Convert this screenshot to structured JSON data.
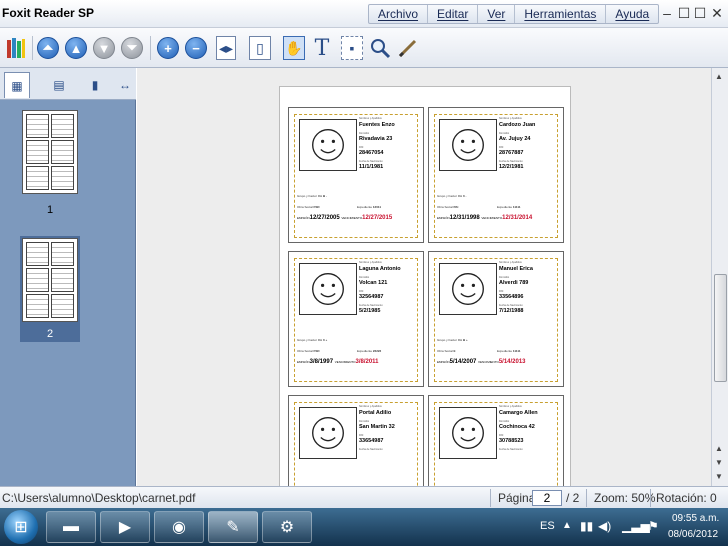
{
  "app": {
    "title": "Foxit Reader SP"
  },
  "menu": [
    {
      "label": "Archivo"
    },
    {
      "label": "Editar"
    },
    {
      "label": "Ver"
    },
    {
      "label": "Herramientas"
    },
    {
      "label": "Ayuda"
    }
  ],
  "window_controls": {
    "minimize": "–",
    "restore": "☐",
    "maximize": "☐",
    "close": "✕"
  },
  "toolbar_icons": [
    "library-icon",
    "first-page-icon",
    "previous-page-icon",
    "next-page-icon",
    "last-page-icon",
    "zoom-in-icon",
    "zoom-out-icon",
    "page-layout-icon",
    "single-page-icon",
    "hand-icon",
    "text-select-icon",
    "snapshot-icon",
    "zoom-tool-icon",
    "annotation-icon"
  ],
  "left_panel": {
    "tabs": [
      "thumbnails-tab-icon",
      "pages-tab-icon",
      "bookmarks-tab-icon",
      "expand-icon"
    ],
    "thumbnails": [
      {
        "page": "1"
      },
      {
        "page": "2"
      }
    ],
    "selected_page": "2"
  },
  "cards": [
    {
      "field1_label": "Nombres y Apellidos",
      "name": "Fuentes Enzo",
      "field2_label": "Domicilio",
      "address": "Rivadavia 23",
      "field3_label": "DNI",
      "dni": "28467054",
      "field4_label": "Fecha de Nacimiento",
      "birth": "11/1/1981",
      "blood_label": "Grupo y Factor RH",
      "blood": "B -",
      "insurance_label": "Obra Social",
      "insurance": "FSD",
      "file_label": "Expediente",
      "file": "12011",
      "issue_label": "EMISIÓN",
      "issue": "12/27/2005",
      "expiry_label": "VENCIMIENTO",
      "expiry": "12/27/2015"
    },
    {
      "field1_label": "Nombres y Apellidos",
      "name": "Cardozo Juan",
      "field2_label": "Domicilio",
      "address": "Av. Jujuy 24",
      "field3_label": "DNI",
      "dni": "28767887",
      "field4_label": "Fecha de Nacimiento",
      "birth": "12/2/1981",
      "blood_label": "Grupo y Factor RH",
      "blood": "0 -",
      "insurance_label": "Obra Social",
      "insurance": "PAI",
      "file_label": "Expediente",
      "file": "11111",
      "issue_label": "EMISIÓN",
      "issue": "12/31/1998",
      "expiry_label": "VENCIMIENTO",
      "expiry": "12/31/2014"
    },
    {
      "field1_label": "Nombres y Apellidos",
      "name": "Laguna Antonio",
      "field2_label": "Domicilio",
      "address": "Volcan 121",
      "field3_label": "DNI",
      "dni": "32564987",
      "field4_label": "Fecha de Nacimiento",
      "birth": "5/2/1985",
      "blood_label": "Grupo y Factor RH",
      "blood": "0 +",
      "insurance_label": "Obra Social",
      "insurance": "FSD",
      "file_label": "Expediente",
      "file": "22222",
      "issue_label": "EMISIÓN",
      "issue": "3/8/1997",
      "expiry_label": "VENCIMIENTO",
      "expiry": "3/8/2011"
    },
    {
      "field1_label": "Nombres y Apellidos",
      "name": "Manuel Erica",
      "field2_label": "Domicilio",
      "address": "Alverdi 789",
      "field3_label": "DNI",
      "dni": "33564896",
      "field4_label": "Fecha de Nacimiento",
      "birth": "7/12/1988",
      "blood_label": "Grupo y Factor RH",
      "blood": "B +",
      "insurance_label": "Obra Social",
      "insurance": "E",
      "file_label": "Expediente",
      "file": "11111",
      "issue_label": "EMISIÓN",
      "issue": "5/14/2007",
      "expiry_label": "VENCIMIENTO",
      "expiry": "5/14/2013"
    },
    {
      "field1_label": "Nombres y Apellidos",
      "name": "Portal Adilio",
      "field2_label": "Domicilio",
      "address": "San Martin 32",
      "field3_label": "DNI",
      "dni": "33654987",
      "field4_label": "Fecha de Nacimiento",
      "birth": "",
      "blood_label": "",
      "blood": "",
      "insurance_label": "",
      "insurance": "",
      "file_label": "",
      "file": "",
      "issue_label": "",
      "issue": "",
      "expiry_label": "",
      "expiry": ""
    },
    {
      "field1_label": "Nombres y Apellidos",
      "name": "Camargo Allen",
      "field2_label": "Domicilio",
      "address": "Cochinoca 42",
      "field3_label": "DNI",
      "dni": "30788523",
      "field4_label": "Fecha de Nacimiento",
      "birth": "",
      "blood_label": "",
      "blood": "",
      "insurance_label": "",
      "insurance": "",
      "file_label": "",
      "file": "",
      "issue_label": "",
      "issue": "",
      "expiry_label": "",
      "expiry": ""
    }
  ],
  "status": {
    "path": "C:\\Users\\alumno\\Desktop\\carnet.pdf",
    "page_label": "Página:",
    "page_value": "2",
    "page_total": "/ 2",
    "zoom": "Zoom: 50%",
    "rotation": "Rotación: 0"
  },
  "taskbar": {
    "start_icon": "windows-start-icon",
    "apps": [
      "explorer-icon",
      "media-player-icon",
      "firefox-icon",
      "foxit-reader-icon",
      "settings-icon"
    ],
    "language": "ES",
    "time": "09:55 a.m.",
    "date": "08/06/2012"
  }
}
